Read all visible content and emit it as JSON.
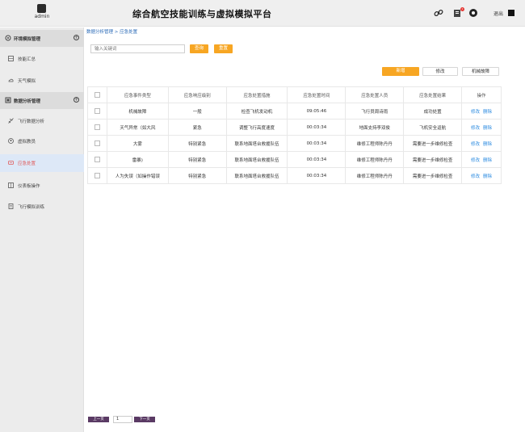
{
  "app": {
    "title": "综合航空技能训练与虚拟模拟平台"
  },
  "user": {
    "name": "admin"
  },
  "header": {
    "logout_label": "退出",
    "notification_count": "1",
    "icons": [
      "link-icon",
      "notification-icon",
      "settings-icon"
    ]
  },
  "sidebar": {
    "groups": [
      {
        "label": "环境模拟管理",
        "toggle": "+"
      },
      {
        "label": "数据分析管理",
        "toggle": "+"
      }
    ],
    "items": [
      {
        "label": "技能汇总",
        "icon": "grid-icon"
      },
      {
        "label": "天气模拟",
        "icon": "cloud-icon"
      },
      {
        "label": "飞行数据分析",
        "icon": "flight-icon"
      },
      {
        "label": "虚拟教员",
        "icon": "person-icon"
      },
      {
        "label": "应急处置",
        "icon": "alert-icon"
      },
      {
        "label": "仪表板操作",
        "icon": "dashboard-icon"
      },
      {
        "label": "飞行模拟训练",
        "icon": "document-icon"
      }
    ]
  },
  "breadcrumb": "数据分析管理 > 应急处置",
  "search": {
    "placeholder": "输入关键词",
    "query_label": "查询",
    "reset_label": "重置"
  },
  "actions": {
    "add_label": "新增",
    "edit_label": "修改",
    "fault_label": "机械故障"
  },
  "table": {
    "columns": [
      "",
      "应急事件类型",
      "应急响应级别",
      "应急处置措施",
      "应急处置时间",
      "应急处置人员",
      "应急处置结果",
      "操作"
    ],
    "rows": [
      {
        "type": "机械故障",
        "level": "一般",
        "measure": "检查飞机发动机",
        "time": "09:05:46",
        "staff": "飞行员周诗雨",
        "result": "成功处置"
      },
      {
        "type": "天气异常（如大风",
        "level": "紧急",
        "measure": "调整飞行高度速度",
        "time": "00:03:34",
        "staff": "地面支持李双俊",
        "result": "飞机安全返航"
      },
      {
        "type": "大雾",
        "level": "特别紧急",
        "measure": "联系地面塔台救援队伍",
        "time": "00:03:34",
        "staff": "维修工程师陈丹丹",
        "result": "需要进一步维修检查"
      },
      {
        "type": "雷暴)",
        "level": "特别紧急",
        "measure": "联系地面塔台救援队伍",
        "time": "00:03:34",
        "staff": "维修工程师陈丹丹",
        "result": "需要进一步维修检查"
      },
      {
        "type": "人为失误（如操作错误",
        "level": "特别紧急",
        "measure": "联系地面塔台救援队伍",
        "time": "00:03:34",
        "staff": "维修工程师陈丹丹",
        "result": "需要进一步维修检查"
      }
    ],
    "op_edit": "修改",
    "op_delete": "删除"
  },
  "pager": {
    "prev_label": "上一页",
    "page": "1",
    "next_label": "下一页"
  },
  "colors": {
    "accent": "#f7a623",
    "link": "#2a8ae0",
    "time_green": "#3bb54a",
    "active_red": "#e05a5a",
    "pager": "#5a3a64"
  }
}
